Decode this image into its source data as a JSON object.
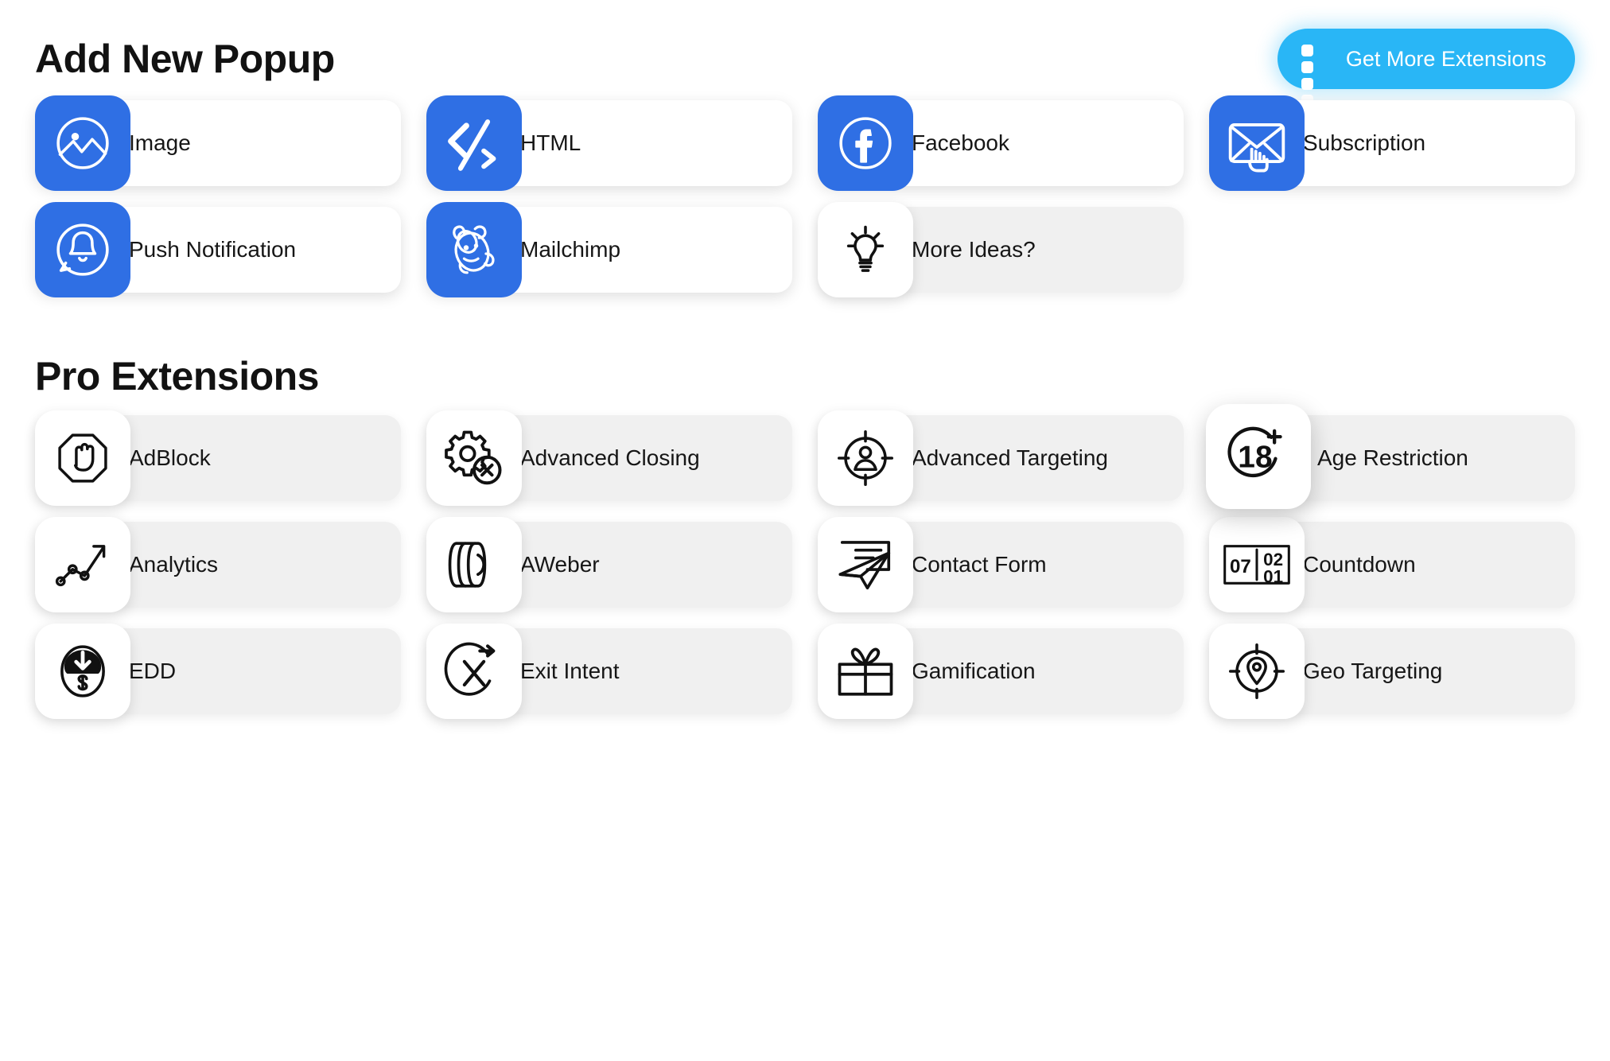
{
  "colors": {
    "accent_button": "#29b6f6",
    "icon_tile_blue": "#2f6fe4",
    "card_gray": "#f0f0f0",
    "card_white": "#ffffff",
    "text": "#161616"
  },
  "header": {
    "title": "Add New Popup",
    "action_button": {
      "label": "Get More Extensions",
      "icon": "grid-four-squares-icon"
    }
  },
  "basic": {
    "items": [
      {
        "label": "Image",
        "icon": "image-picture-icon",
        "tile": "blue",
        "card": "white"
      },
      {
        "label": "HTML",
        "icon": "code-brackets-icon",
        "tile": "blue",
        "card": "white"
      },
      {
        "label": "Facebook",
        "icon": "facebook-icon",
        "tile": "blue",
        "card": "white"
      },
      {
        "label": "Subscription",
        "icon": "envelope-click-icon",
        "tile": "blue",
        "card": "white"
      },
      {
        "label": "Push Notification",
        "icon": "bell-notification-icon",
        "tile": "blue",
        "card": "white"
      },
      {
        "label": "Mailchimp",
        "icon": "mailchimp-monkey-icon",
        "tile": "blue",
        "card": "white"
      },
      {
        "label": "More Ideas?",
        "icon": "lightbulb-idea-icon",
        "tile": "white",
        "card": "gray"
      }
    ]
  },
  "pro": {
    "title": "Pro Extensions",
    "items": [
      {
        "label": "AdBlock",
        "icon": "hand-stop-octagon-icon",
        "tile": "white",
        "card": "gray",
        "raised": false
      },
      {
        "label": "Advanced Closing",
        "icon": "gear-close-icon",
        "tile": "white",
        "card": "gray",
        "raised": false
      },
      {
        "label": "Advanced Targeting",
        "icon": "person-crosshair-icon",
        "tile": "white",
        "card": "gray",
        "raised": false
      },
      {
        "label": "Age Restriction",
        "icon": "eighteen-plus-icon",
        "tile": "white",
        "card": "gray",
        "raised": true,
        "badge_text": "18",
        "badge_plus": "+"
      },
      {
        "label": "Analytics",
        "icon": "line-chart-arrow-icon",
        "tile": "white",
        "card": "gray",
        "raised": false
      },
      {
        "label": "AWeber",
        "icon": "aweber-stack-icon",
        "tile": "white",
        "card": "gray",
        "raised": false
      },
      {
        "label": "Contact Form",
        "icon": "paper-plane-form-icon",
        "tile": "white",
        "card": "gray",
        "raised": false
      },
      {
        "label": "Countdown",
        "icon": "countdown-digits-icon",
        "tile": "white",
        "card": "gray",
        "raised": false,
        "digits": [
          "07",
          "02",
          "01"
        ]
      },
      {
        "label": "EDD",
        "icon": "edd-dollar-download-icon",
        "tile": "white",
        "card": "gray",
        "raised": false
      },
      {
        "label": "Exit Intent",
        "icon": "exit-intent-x-arrow-icon",
        "tile": "white",
        "card": "gray",
        "raised": false
      },
      {
        "label": "Gamification",
        "icon": "gift-box-icon",
        "tile": "white",
        "card": "gray",
        "raised": false
      },
      {
        "label": "Geo Targeting",
        "icon": "map-pin-crosshair-icon",
        "tile": "white",
        "card": "gray",
        "raised": false
      }
    ]
  }
}
